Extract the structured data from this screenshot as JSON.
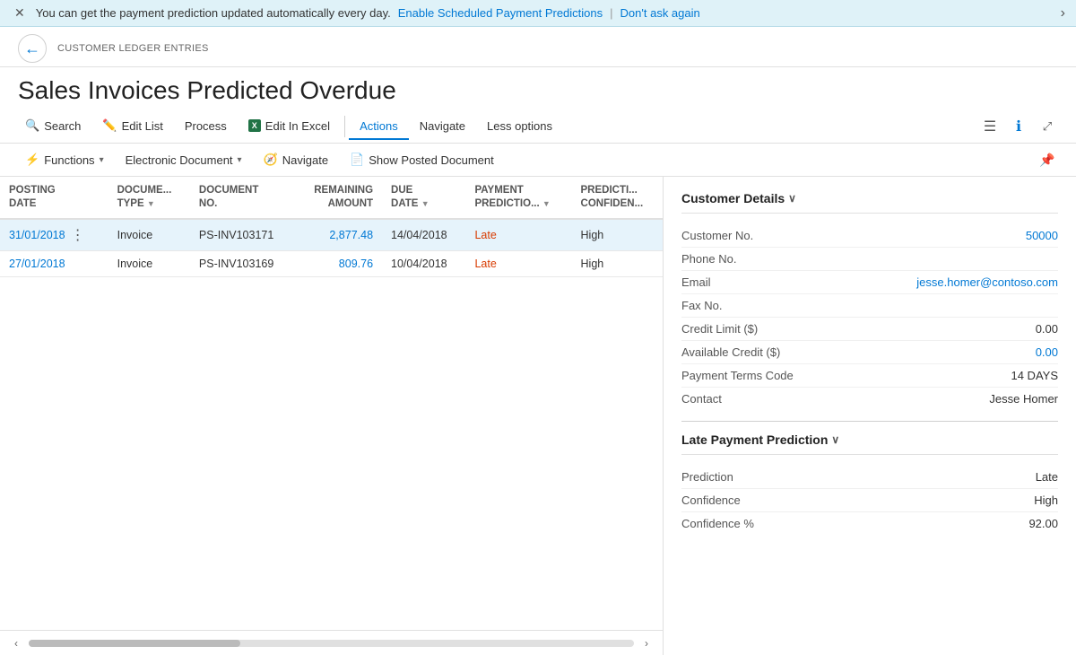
{
  "notification": {
    "message": "You can get the payment prediction updated automatically every day.",
    "enable_link": "Enable Scheduled Payment Predictions",
    "separator": "|",
    "dismiss_link": "Don't ask again"
  },
  "breadcrumb": "CUSTOMER LEDGER ENTRIES",
  "page_title": "Sales Invoices Predicted Overdue",
  "toolbar_row1": {
    "search_label": "Search",
    "edit_list_label": "Edit List",
    "process_label": "Process",
    "edit_excel_label": "Edit In Excel",
    "actions_label": "Actions",
    "navigate_label": "Navigate",
    "less_options_label": "Less options"
  },
  "toolbar_row2": {
    "functions_label": "Functions",
    "electronic_doc_label": "Electronic Document",
    "navigate_label": "Navigate",
    "show_posted_label": "Show Posted Document"
  },
  "table": {
    "columns": [
      {
        "key": "posting_date",
        "label": "POSTING DATE",
        "sortable": false
      },
      {
        "key": "doc_type",
        "label": "DOCUME... TYPE",
        "sortable": true
      },
      {
        "key": "doc_no",
        "label": "DOCUMENT NO.",
        "sortable": false
      },
      {
        "key": "remaining",
        "label": "REMAINING AMOUNT",
        "sortable": false
      },
      {
        "key": "due_date",
        "label": "DUE DATE",
        "sortable": true
      },
      {
        "key": "payment_pred",
        "label": "PAYMENT PREDICTIO...",
        "sortable": true
      },
      {
        "key": "confidence",
        "label": "PREDICTI... CONFIDEN...",
        "sortable": false
      }
    ],
    "rows": [
      {
        "posting_date": "31/01/2018",
        "doc_type": "Invoice",
        "doc_no": "PS-INV103171",
        "remaining": "2,877.48",
        "due_date": "14/04/2018",
        "payment_pred": "Late",
        "confidence": "High",
        "selected": true
      },
      {
        "posting_date": "27/01/2018",
        "doc_type": "Invoice",
        "doc_no": "PS-INV103169",
        "remaining": "809.76",
        "due_date": "10/04/2018",
        "payment_pred": "Late",
        "confidence": "High",
        "selected": false
      }
    ]
  },
  "customer_details": {
    "section_title": "Customer Details",
    "fields": [
      {
        "label": "Customer No.",
        "value": "50000",
        "type": "link"
      },
      {
        "label": "Phone No.",
        "value": "",
        "type": "plain"
      },
      {
        "label": "Email",
        "value": "jesse.homer@contoso.com",
        "type": "link"
      },
      {
        "label": "Fax No.",
        "value": "",
        "type": "plain"
      },
      {
        "label": "Credit Limit ($)",
        "value": "0.00",
        "type": "plain"
      },
      {
        "label": "Available Credit ($)",
        "value": "0.00",
        "type": "zero"
      },
      {
        "label": "Payment Terms Code",
        "value": "14 DAYS",
        "type": "plain"
      },
      {
        "label": "Contact",
        "value": "Jesse Homer",
        "type": "plain"
      }
    ]
  },
  "late_payment": {
    "section_title": "Late Payment Prediction",
    "fields": [
      {
        "label": "Prediction",
        "value": "Late",
        "type": "plain"
      },
      {
        "label": "Confidence",
        "value": "High",
        "type": "plain"
      },
      {
        "label": "Confidence %",
        "value": "92.00",
        "type": "plain"
      }
    ]
  }
}
